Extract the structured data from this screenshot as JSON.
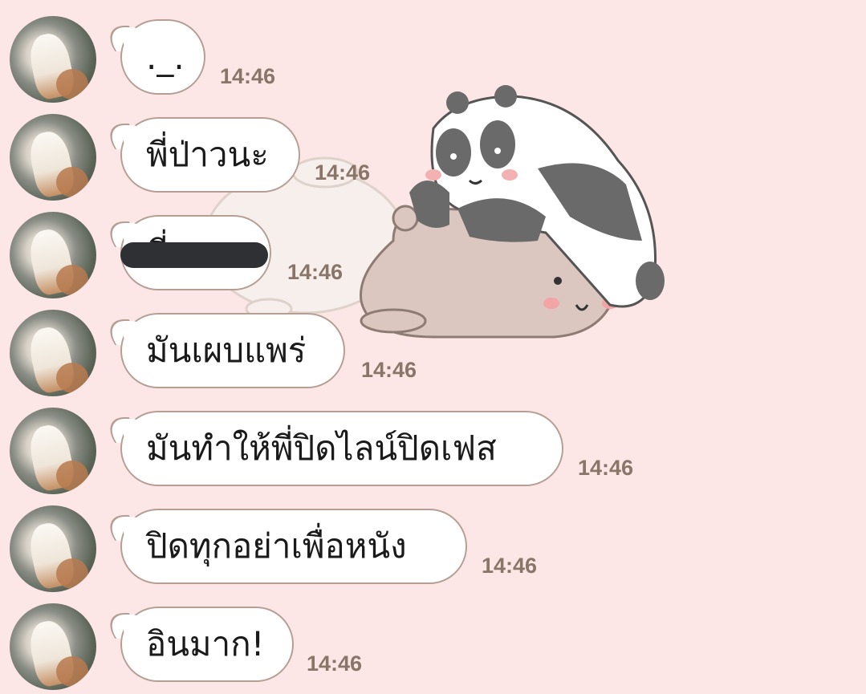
{
  "messages": [
    {
      "text": "._.",
      "time": "14:46"
    },
    {
      "text": "พี่ป่าวนะ",
      "time": "14:46"
    },
    {
      "text": "พี่ ...",
      "time": "14:46"
    },
    {
      "text": "มันเผบแพร่",
      "time": "14:46"
    },
    {
      "text": "มันทำให้พี่ปิดไลน์ปิดเฟส",
      "time": "14:46"
    },
    {
      "text": "ปิดทุกอย่าเพื่อหนัง",
      "time": "14:46"
    },
    {
      "text": "อินมาก!",
      "time": "14:46"
    }
  ],
  "sticker": {
    "icon": "panda-and-bears-sticker"
  },
  "colors": {
    "background": "#fde6e6",
    "bubble_border": "#b59f95",
    "time_text": "#8a7668"
  }
}
